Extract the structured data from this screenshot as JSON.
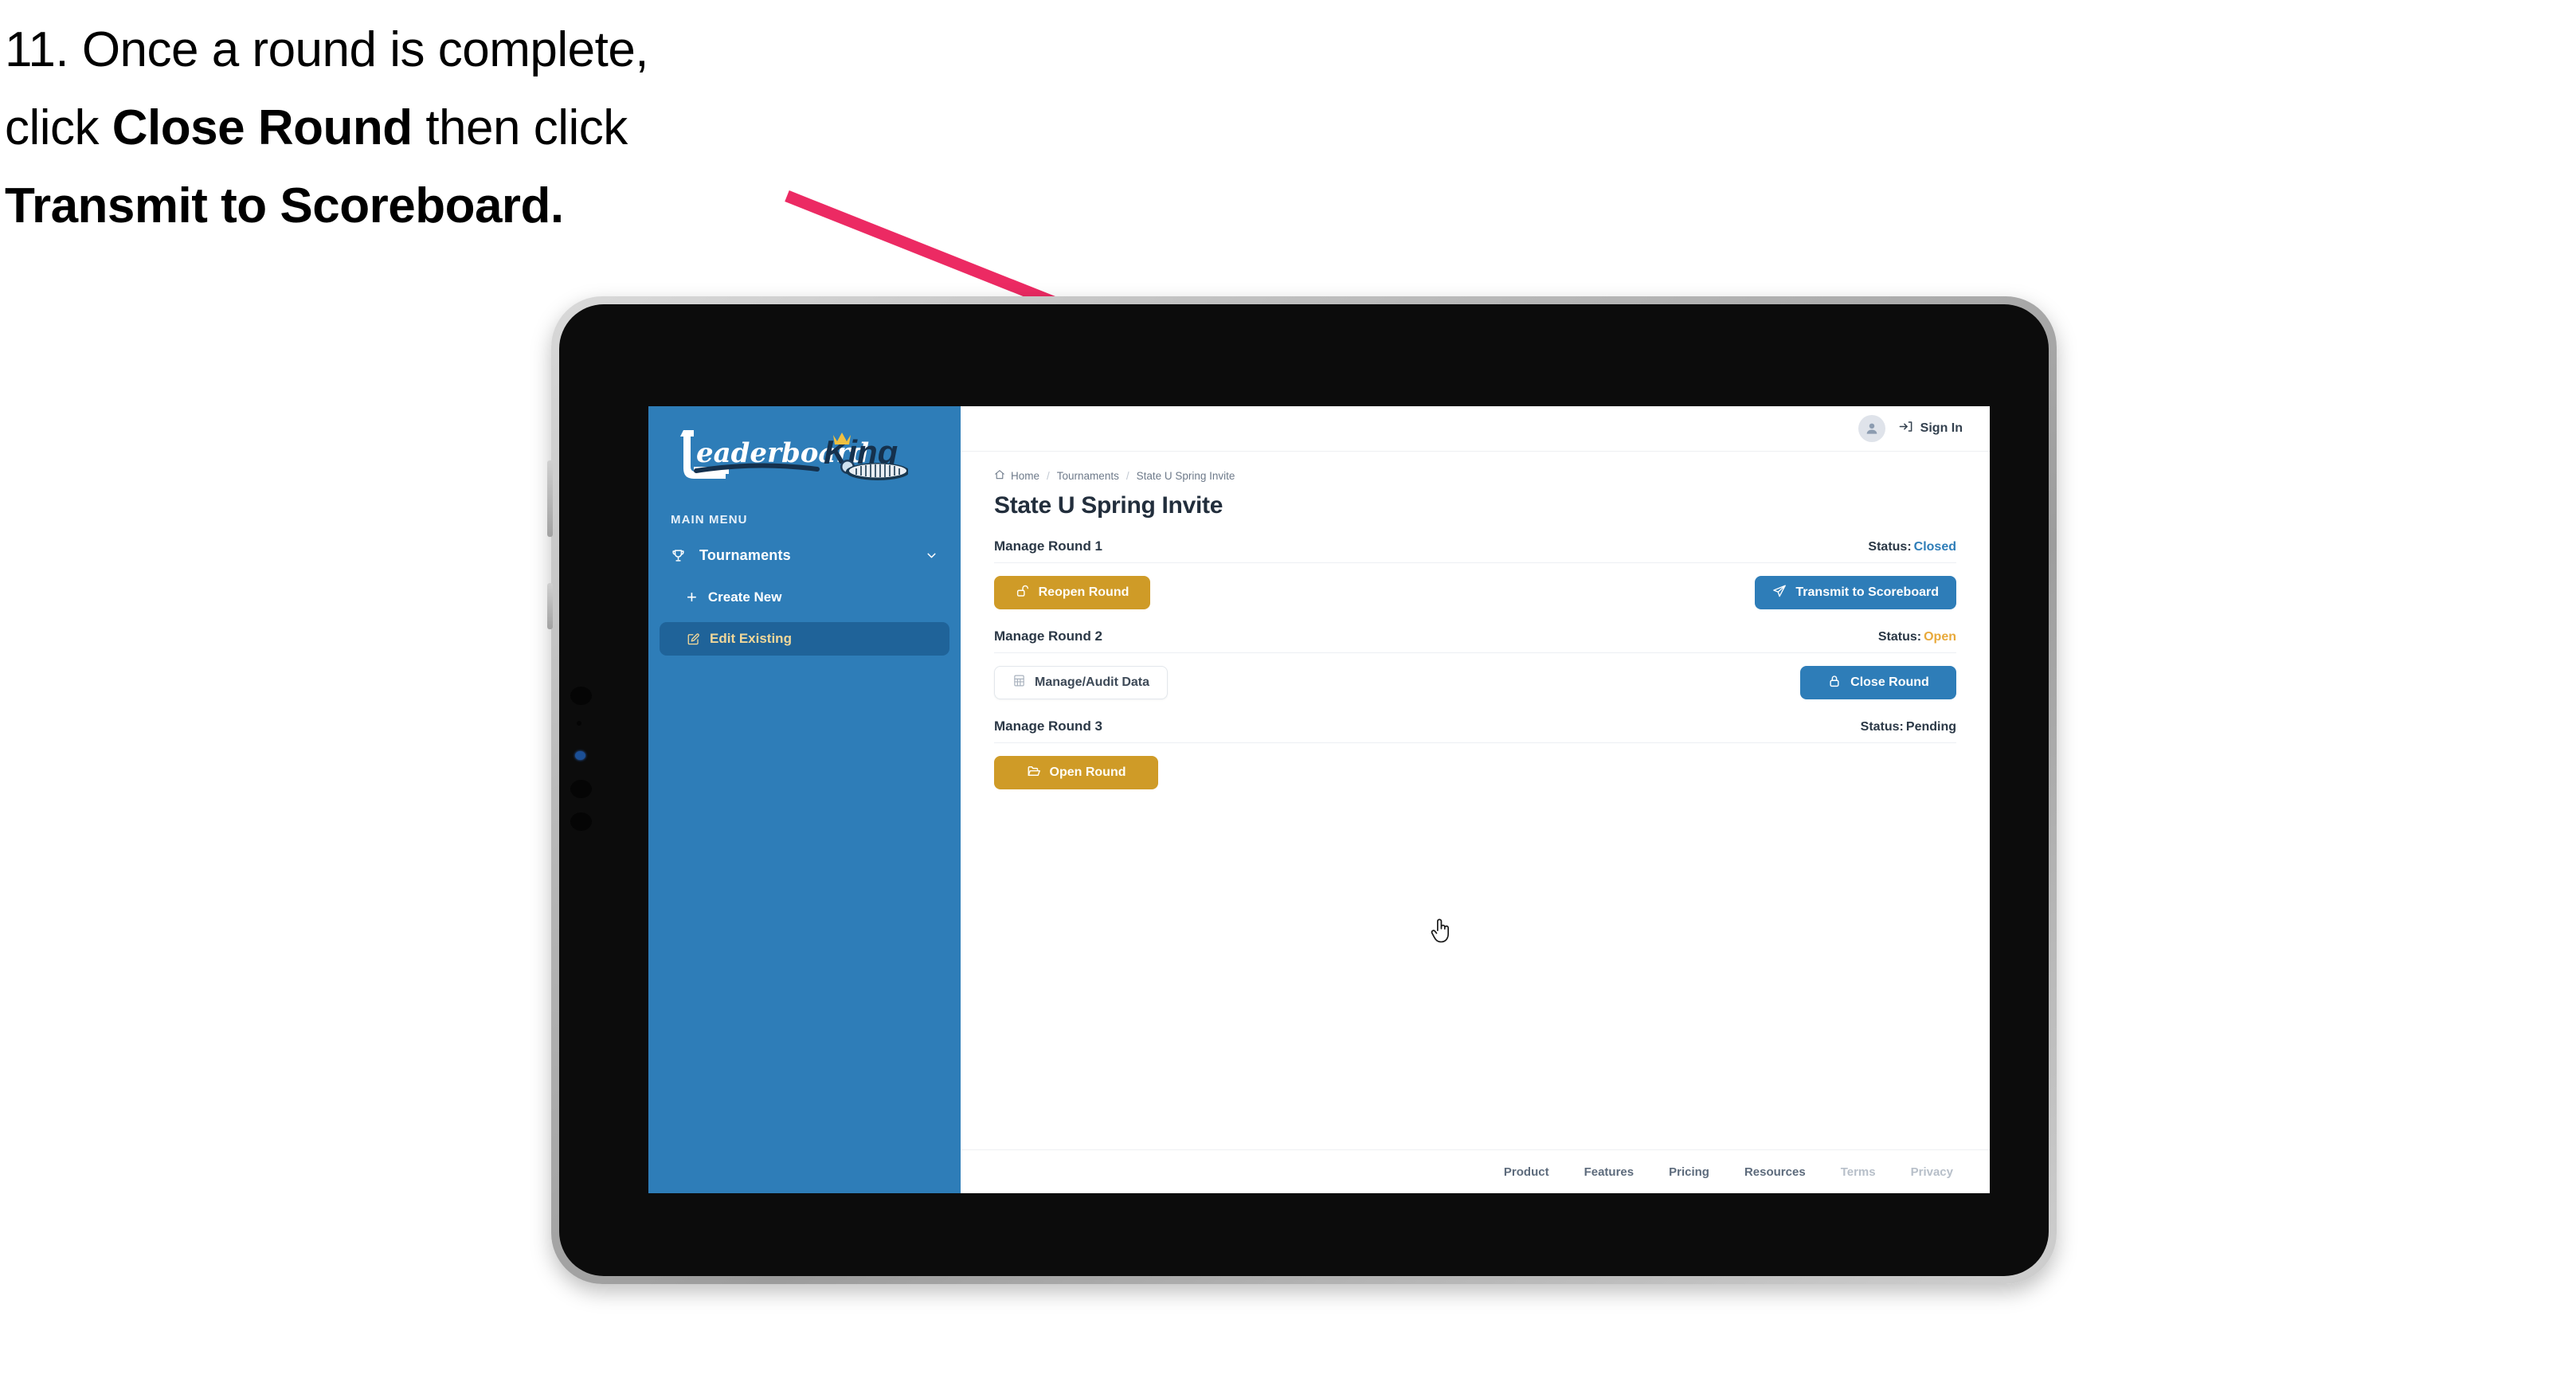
{
  "caption": {
    "line1_plain": "11. Once a round is complete,",
    "line2_pre": "click ",
    "line2_bold": "Close Round",
    "line2_post": " then click",
    "line3_bold": "Transmit to Scoreboard."
  },
  "annotation": {
    "arrow_color": "#ec2a63",
    "arrow_name": "pointer-arrow-to-transmit-button"
  },
  "device": {
    "type": "tablet",
    "frame_color": "#b9b9b9",
    "bezel_color": "#0c0c0c"
  },
  "sidebar": {
    "logo_text_primary": "Leaderboard",
    "logo_text_secondary": "King",
    "section_label": "MAIN MENU",
    "background_color": "#2e7db8",
    "active_background_color": "#1f6399",
    "active_text_color": "#f0d79a",
    "items": [
      {
        "label": "Tournaments",
        "icon": "trophy-icon",
        "expander": "chevron-down-icon"
      },
      {
        "label": "Create New",
        "icon": "plus-icon"
      },
      {
        "label": "Edit Existing",
        "icon": "edit-square-icon",
        "active": true
      }
    ]
  },
  "topbar": {
    "avatar_icon": "user-avatar-icon",
    "signin_icon": "sign-in-arrow-icon",
    "signin_label": "Sign In"
  },
  "breadcrumb": {
    "home_icon": "home-icon",
    "items": [
      "Home",
      "Tournaments",
      "State U Spring Invite"
    ],
    "separator": "/"
  },
  "page": {
    "title": "State U Spring Invite"
  },
  "rounds": [
    {
      "title": "Manage Round 1",
      "status_label": "Status:",
      "status_value": "Closed",
      "status_color": "#2e7db8",
      "left_button": {
        "label": "Reopen Round",
        "icon": "unlock-icon",
        "style": "gold"
      },
      "right_button": {
        "label": "Transmit to Scoreboard",
        "icon": "paper-plane-icon",
        "style": "blue"
      }
    },
    {
      "title": "Manage Round 2",
      "status_label": "Status:",
      "status_value": "Open",
      "status_color": "#e8a93a",
      "left_button": {
        "label": "Manage/Audit Data",
        "icon": "table-grid-icon",
        "style": "ghost"
      },
      "right_button": {
        "label": "Close Round",
        "icon": "lock-icon",
        "style": "blue"
      }
    },
    {
      "title": "Manage Round 3",
      "status_label": "Status:",
      "status_value": "Pending",
      "status_color": "#2b3846",
      "left_button": {
        "label": "Open Round",
        "icon": "folder-open-icon",
        "style": "gold"
      },
      "right_button": null
    }
  ],
  "footer": {
    "links": [
      {
        "label": "Product",
        "muted": false
      },
      {
        "label": "Features",
        "muted": false
      },
      {
        "label": "Pricing",
        "muted": false
      },
      {
        "label": "Resources",
        "muted": false
      },
      {
        "label": "Terms",
        "muted": true
      },
      {
        "label": "Privacy",
        "muted": true
      }
    ]
  },
  "cursor": {
    "icon": "pointing-hand-cursor"
  }
}
